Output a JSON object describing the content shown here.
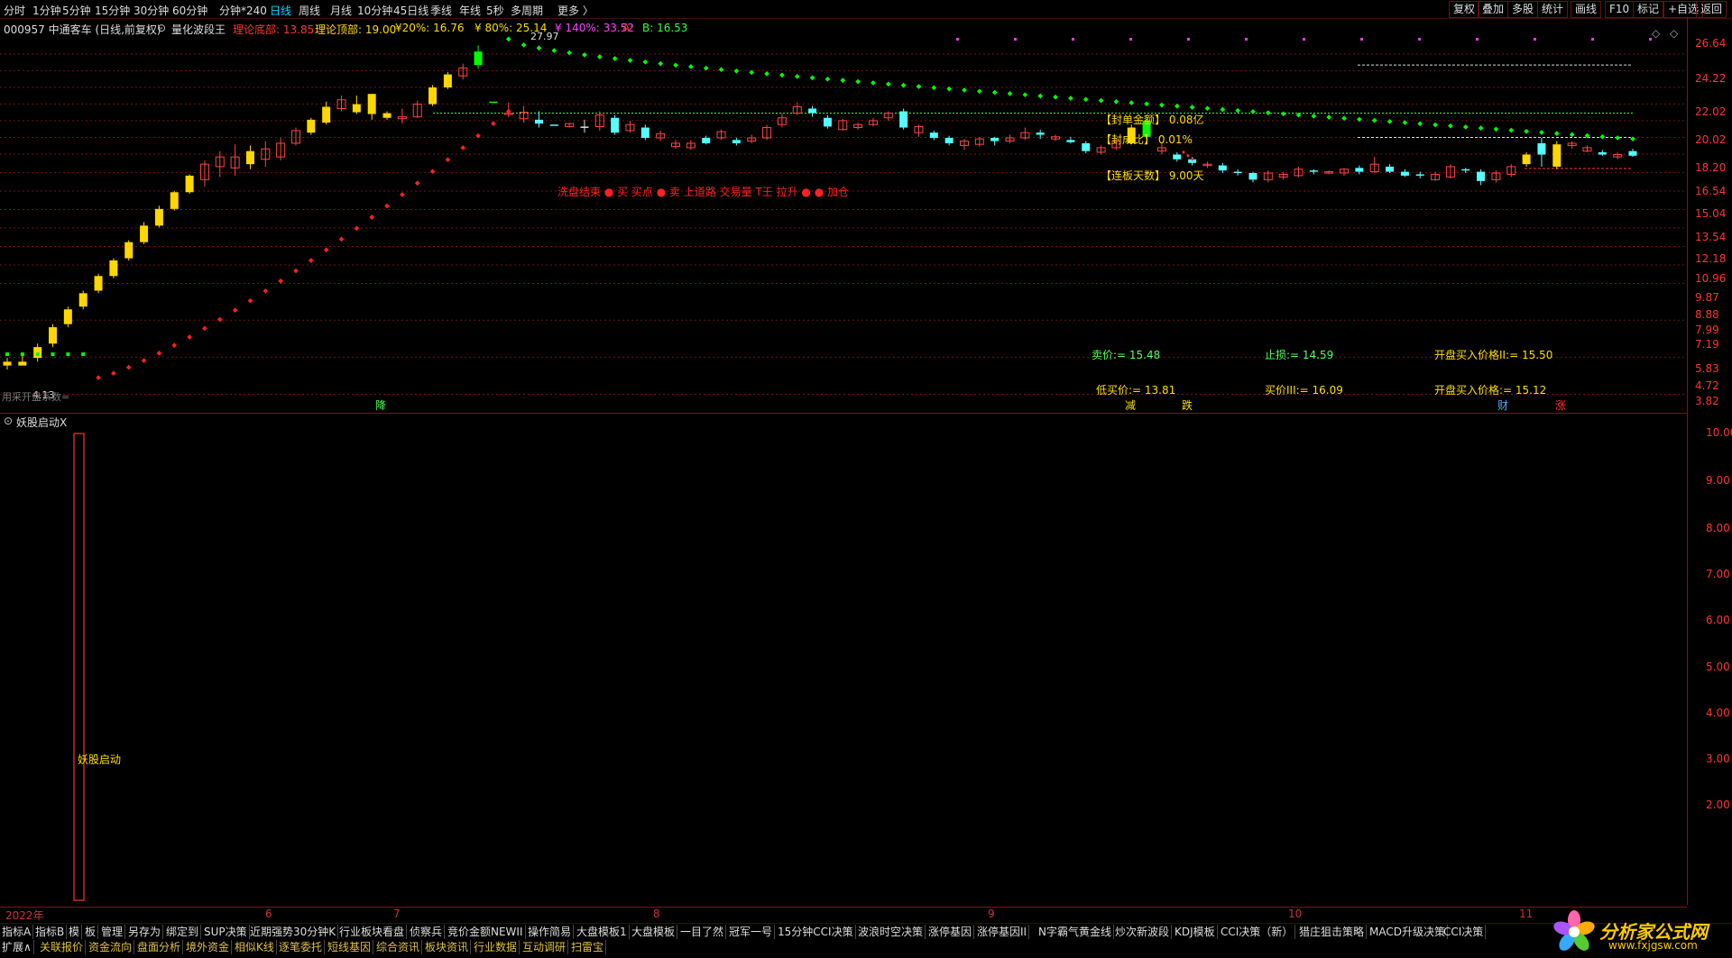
{
  "toolbar": {
    "timeframes": [
      "分时",
      "1分钟",
      "5分钟",
      "15分钟",
      "30分钟",
      "60分钟",
      "分钟*240",
      "日线",
      "周线",
      "月线",
      "10分钟",
      "45日线",
      "季线",
      "年线",
      "5秒",
      "多周期",
      "更多 〉"
    ],
    "active_timeframe": "日线",
    "right_buttons": [
      "复权",
      "叠加",
      "多股",
      "统计",
      "画线",
      "F10",
      "标记",
      "+自选",
      "返回"
    ]
  },
  "info": {
    "stock": "000957 中通客车 (日线,前复权)",
    "indicator": "量化波段王",
    "theory_bottom": "理论底部: 13.85",
    "theory_top": "理论顶部: 19.00",
    "p20": "¥20%: 16.76",
    "p80": "¥ 80%: 25.14",
    "p140": "¥ 140%: 33.52",
    "a_label": "A:",
    "b_label": "B: 16.53"
  },
  "price_axis": [
    "26.64",
    "24.22",
    "22.02",
    "20.02",
    "18.20",
    "16.54",
    "15.04",
    "13.54",
    "12.18",
    "10.96",
    "9.87",
    "8.88",
    "7.99",
    "7.19",
    "5.83",
    "4.72",
    "3.82"
  ],
  "annotations": {
    "high_label": "27.97",
    "low_label": "4.13",
    "left_label": "用采开盘系数=",
    "seal_amount": "【封单金额】 0.08亿",
    "seal_ratio": "【封成比】 0.01%",
    "limit_days": "【连板天数】 9.00天",
    "red_strip": "洗盘结束  ● 买  买点  ●  卖  上道路  交易量  T王  拉升 ● ● 加仓",
    "sell_price": "卖价:= 15.48",
    "stop_loss": "止损:= 14.59",
    "open_buy_2": "开盘买入价格II:= 15.50",
    "low_buy": "低买价:= 13.81",
    "buy_price_3": "买价III:= 16.09",
    "open_buy": "开盘买入价格:= 15.12",
    "markers": [
      "降",
      "减",
      "跌",
      "财",
      "涨"
    ]
  },
  "sub_chart": {
    "title": "妖股启动X",
    "label": "妖股启动",
    "axis": [
      "10.00",
      "9.00",
      "8.00",
      "7.00",
      "6.00",
      "5.00",
      "4.00",
      "3.00",
      "2.00"
    ]
  },
  "date_axis": [
    "2022年",
    "6",
    "7",
    "8",
    "9",
    "10",
    "11"
  ],
  "tabs_row1": [
    "指标A",
    "指标B",
    "模",
    "板",
    "管理",
    "另存为",
    "绑定到",
    "SUP决策",
    "近期强势30分钟K",
    "行业板块看盘",
    "侦察兵",
    "竞价金额NEWII",
    "操作简易",
    "大盘模板1",
    "大盘模板",
    "一目了然",
    "冠军一号",
    "15分钟CCI决策",
    "波浪时空决策",
    "涨停基因",
    "涨停基因II",
    "N字霸气黄金线",
    "炒次新波段",
    "KDJ模板",
    "CCI决策（新）",
    "猎庄狙击策略",
    "MACD升级决策",
    "CCI决策"
  ],
  "tabs_row2": [
    "扩展∧",
    "关联报价",
    "资金流向",
    "盘面分析",
    "境外资金",
    "相似K线",
    "逐笔委托",
    "短线基因",
    "综合资讯",
    "板块资讯",
    "行业数据",
    "互动调研",
    "扫雷宝"
  ],
  "logo": {
    "text": "分析家公式网",
    "url_text": "www.fxjgsw.com"
  },
  "colors": {
    "up": "#ffd700",
    "down": "#55ffff",
    "rise_box": "#ff4444",
    "green_dots": "#00ff00",
    "red_dots": "#ff2020",
    "grid": "#7a1010"
  },
  "chart_data": {
    "type": "candlestick",
    "candles": [
      [
        4.6,
        4.5,
        4.4,
        4.7,
        "y"
      ],
      [
        4.5,
        4.6,
        4.5,
        4.8,
        "y"
      ],
      [
        4.7,
        5.0,
        4.6,
        5.1,
        "y"
      ],
      [
        5.1,
        5.6,
        5.0,
        5.7,
        "y"
      ],
      [
        5.7,
        6.2,
        5.6,
        6.3,
        "y"
      ],
      [
        6.3,
        6.8,
        6.2,
        6.9,
        "y"
      ],
      [
        6.9,
        7.5,
        6.8,
        7.6,
        "y"
      ],
      [
        7.5,
        8.2,
        7.4,
        8.3,
        "y"
      ],
      [
        8.3,
        9.1,
        8.2,
        9.2,
        "y"
      ],
      [
        9.1,
        10.0,
        9.0,
        10.2,
        "y"
      ],
      [
        10.0,
        11.0,
        9.9,
        11.2,
        "y"
      ],
      [
        11.0,
        12.1,
        10.9,
        12.2,
        "y"
      ],
      [
        12.1,
        13.3,
        12.0,
        13.4,
        "y"
      ],
      [
        13.0,
        14.2,
        12.5,
        14.5,
        "r"
      ],
      [
        14.0,
        14.8,
        13.2,
        15.3,
        "r"
      ],
      [
        14.8,
        13.9,
        13.3,
        15.9,
        "r"
      ],
      [
        14.2,
        15.3,
        13.8,
        15.8,
        "y"
      ],
      [
        15.5,
        14.6,
        14.0,
        16.2,
        "r"
      ],
      [
        14.8,
        16.0,
        14.5,
        16.5,
        "r"
      ],
      [
        16.0,
        17.2,
        15.8,
        17.5,
        "r"
      ],
      [
        17.0,
        18.3,
        16.8,
        18.5,
        "y"
      ],
      [
        18.0,
        19.7,
        17.8,
        20.3,
        "y"
      ],
      [
        19.5,
        20.5,
        19.2,
        21.0,
        "r"
      ],
      [
        20.0,
        19.1,
        18.9,
        21.0,
        "y"
      ],
      [
        18.9,
        21.2,
        18.3,
        21.2,
        "y"
      ],
      [
        19.0,
        18.5,
        18.3,
        19.2,
        "y"
      ],
      [
        18.4,
        18.6,
        17.9,
        19.5,
        "r"
      ],
      [
        18.6,
        20.0,
        18.5,
        20.4,
        "r"
      ],
      [
        20.0,
        22.0,
        19.8,
        22.3,
        "y"
      ],
      [
        22.0,
        23.7,
        21.8,
        24.0,
        "y"
      ],
      [
        23.5,
        24.6,
        23.0,
        25.2,
        "r"
      ],
      [
        25.0,
        27.0,
        24.5,
        27.97,
        "g"
      ],
      [
        20.3,
        20.3,
        20.3,
        20.3,
        "g"
      ],
      [
        19.0,
        19.0,
        18.6,
        20.2,
        "r"
      ],
      [
        19.1,
        18.4,
        18.0,
        19.8,
        "r"
      ],
      [
        18.3,
        17.9,
        17.5,
        19.2,
        "c"
      ],
      [
        17.8,
        17.8,
        17.8,
        17.8,
        "c"
      ],
      [
        17.6,
        17.9,
        17.5,
        18.0,
        "r"
      ],
      [
        17.5,
        17.6,
        17.0,
        18.3,
        "w"
      ],
      [
        18.8,
        17.6,
        17.2,
        19.2,
        "r"
      ],
      [
        18.5,
        17.0,
        16.8,
        18.8,
        "c"
      ],
      [
        17.2,
        17.8,
        17.0,
        18.2,
        "r"
      ],
      [
        17.5,
        16.5,
        16.3,
        17.8,
        "c"
      ],
      [
        16.5,
        16.9,
        16.2,
        17.2,
        "r"
      ],
      [
        16.0,
        15.7,
        15.5,
        16.3,
        "r"
      ],
      [
        15.6,
        16.0,
        15.4,
        16.3,
        "r"
      ],
      [
        16.0,
        16.5,
        15.9,
        16.7,
        "c"
      ],
      [
        16.5,
        17.1,
        16.3,
        17.3,
        "r"
      ],
      [
        16.3,
        16.0,
        15.8,
        16.5,
        "c"
      ],
      [
        16.2,
        16.5,
        16.0,
        16.8,
        "r"
      ],
      [
        16.5,
        17.5,
        16.3,
        17.8,
        "r"
      ],
      [
        17.8,
        18.5,
        17.5,
        19.0,
        "r"
      ],
      [
        19.0,
        19.7,
        18.8,
        20.2,
        "r"
      ],
      [
        19.5,
        19.0,
        18.6,
        19.8,
        "c"
      ],
      [
        18.5,
        17.6,
        17.4,
        18.8,
        "c"
      ],
      [
        17.3,
        18.2,
        17.2,
        18.4,
        "r"
      ],
      [
        17.5,
        17.8,
        17.3,
        18.0,
        "r"
      ],
      [
        17.8,
        18.2,
        17.6,
        18.5,
        "r"
      ],
      [
        18.5,
        19.0,
        18.2,
        19.2,
        "r"
      ],
      [
        19.2,
        17.5,
        17.3,
        19.5,
        "c"
      ],
      [
        17.6,
        17.0,
        16.6,
        17.8,
        "r"
      ],
      [
        17.0,
        16.5,
        16.3,
        17.2,
        "c"
      ],
      [
        16.5,
        16.0,
        15.8,
        16.7,
        "c"
      ],
      [
        16.2,
        15.8,
        15.4,
        16.4,
        "r"
      ],
      [
        15.9,
        16.4,
        15.7,
        16.6,
        "r"
      ],
      [
        16.5,
        16.2,
        15.8,
        16.6,
        "c"
      ],
      [
        16.2,
        16.5,
        16.0,
        16.8,
        "r"
      ],
      [
        16.5,
        17.0,
        16.3,
        17.5,
        "r"
      ],
      [
        17.0,
        16.8,
        16.4,
        17.3,
        "c"
      ],
      [
        16.6,
        16.4,
        16.2,
        16.8,
        "r"
      ],
      [
        16.3,
        16.1,
        16.0,
        16.6,
        "c"
      ],
      [
        16.0,
        15.3,
        15.1,
        16.2,
        "c"
      ],
      [
        15.2,
        15.6,
        15.0,
        15.8,
        "r"
      ],
      [
        15.6,
        16.2,
        15.4,
        16.5,
        "r"
      ],
      [
        16.0,
        17.5,
        15.9,
        17.8,
        "y"
      ],
      [
        16.6,
        18.2,
        16.3,
        18.3,
        "g"
      ],
      [
        15.3,
        15.6,
        15.0,
        16.0,
        "r"
      ],
      [
        15.0,
        14.6,
        14.4,
        15.2,
        "c"
      ],
      [
        14.6,
        14.3,
        14.1,
        14.8,
        "c"
      ],
      [
        14.2,
        14.1,
        13.9,
        14.4,
        "r"
      ],
      [
        14.1,
        13.7,
        13.5,
        14.3,
        "c"
      ],
      [
        13.6,
        13.5,
        13.3,
        13.8,
        "c"
      ],
      [
        13.5,
        13.0,
        12.8,
        13.6,
        "c"
      ],
      [
        13.0,
        13.5,
        12.8,
        13.7,
        "r"
      ],
      [
        13.2,
        13.4,
        13.0,
        13.6,
        "r"
      ],
      [
        13.3,
        13.8,
        13.2,
        14.0,
        "r"
      ],
      [
        13.7,
        13.6,
        13.4,
        13.8,
        "c"
      ],
      [
        13.6,
        13.5,
        13.4,
        13.7,
        "r"
      ],
      [
        13.5,
        13.8,
        13.3,
        13.9,
        "r"
      ],
      [
        13.9,
        13.6,
        13.4,
        14.1,
        "c"
      ],
      [
        13.6,
        14.2,
        13.5,
        14.8,
        "r"
      ],
      [
        14.0,
        13.6,
        13.5,
        14.2,
        "c"
      ],
      [
        13.6,
        13.3,
        13.2,
        13.8,
        "c"
      ],
      [
        13.3,
        13.4,
        13.1,
        13.6,
        "c"
      ],
      [
        13.4,
        13.0,
        12.9,
        13.6,
        "r"
      ],
      [
        13.2,
        14.0,
        13.1,
        14.2,
        "r"
      ],
      [
        13.8,
        13.7,
        13.5,
        13.9,
        "c"
      ],
      [
        13.6,
        12.9,
        12.6,
        13.8,
        "c"
      ],
      [
        13.0,
        13.5,
        12.8,
        13.7,
        "r"
      ],
      [
        13.4,
        14.0,
        13.2,
        14.2,
        "r"
      ],
      [
        14.2,
        15.0,
        14.0,
        15.2,
        "y"
      ],
      [
        15.0,
        16.0,
        14.0,
        16.5,
        "c"
      ],
      [
        14.0,
        15.9,
        13.8,
        16.2,
        "y"
      ],
      [
        16.0,
        15.8,
        15.5,
        16.2,
        "r"
      ],
      [
        15.6,
        15.3,
        15.2,
        15.8,
        "r"
      ],
      [
        15.2,
        15.0,
        14.9,
        15.4,
        "c"
      ],
      [
        14.8,
        15.0,
        14.6,
        15.2,
        "r"
      ],
      [
        15.3,
        14.9,
        14.8,
        15.5,
        "c"
      ]
    ]
  }
}
